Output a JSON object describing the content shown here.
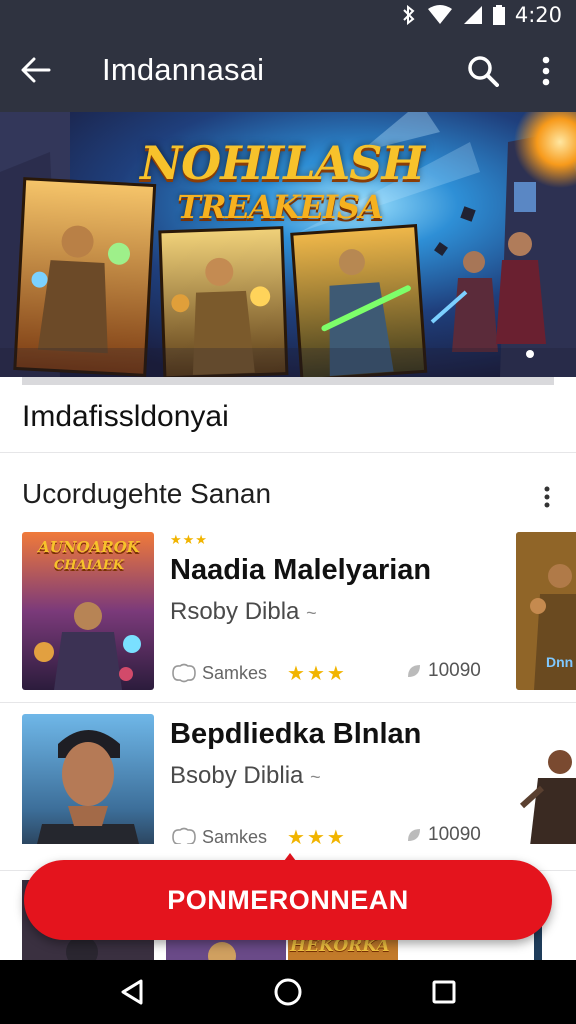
{
  "status_bar": {
    "time": "4:20",
    "icons": [
      "bluetooth-icon",
      "wifi-icon",
      "signal-icon",
      "battery-icon"
    ]
  },
  "app_bar": {
    "title": "Imdannasai",
    "icons": {
      "back": "arrow-left-icon",
      "search": "search-icon",
      "more": "more-vert-icon"
    }
  },
  "banner": {
    "title_line1": "NOHILASH",
    "title_line2": "TREAKEISA"
  },
  "section": {
    "title": "Imdafissldonyai"
  },
  "list": {
    "header": "Ucordugehte Sanan",
    "items": [
      {
        "thumb_title_1": "AUNOAROK",
        "thumb_title_2": "CHAIAEK",
        "name": "Naadia Malelyarian",
        "author": "Rsoby Dibla",
        "author_suffix": "~",
        "sales": "Samkes",
        "rating_stars": "★★★",
        "small_stars": "★★★",
        "count": "10090",
        "peek_label": "Dnn"
      },
      {
        "name": "Bepdliedka Blnlan",
        "author": "Bsoby Diblia",
        "author_suffix": "~",
        "sales": "Samkes",
        "rating_stars": "★★★",
        "count": "10090"
      }
    ]
  },
  "bottom_strip": {
    "label": "HEKORKA"
  },
  "cta": {
    "label": "PONMERONNEAN"
  },
  "nav_bar": {
    "icons": {
      "back": "nav-back-icon",
      "home": "nav-home-icon",
      "recents": "nav-recents-icon"
    }
  },
  "colors": {
    "app_bar": "#2f3340",
    "cta": "#e4141d",
    "star": "#f1b400",
    "banner_title": "#f7c22b"
  }
}
